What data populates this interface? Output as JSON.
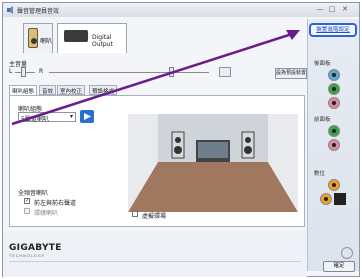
{
  "window": {
    "title": "聲音管理員音效",
    "controls": [
      "—",
      "□",
      "✕"
    ]
  },
  "device_tabs": [
    {
      "label": "喇叭",
      "icon": "speaker-icon"
    },
    {
      "label": "Digital Output",
      "icon": "digital-output-icon"
    }
  ],
  "main_volume": {
    "label": "主音量",
    "left": "L",
    "right": "R",
    "set_default": "設為預設裝置"
  },
  "inner_tabs": [
    "喇叭組態",
    "音效",
    "室內校正",
    "預設格式"
  ],
  "speaker_config": {
    "label": "喇叭組態",
    "selected": "5聲道喇叭"
  },
  "fullrange": {
    "title": "全頻音喇叭",
    "front": "前左與前右聲道",
    "surround": "環繞喇叭",
    "front_checked": true,
    "surround_checked": false
  },
  "virtual_surround": "虛擬環場",
  "right_panel": {
    "advanced_link": "裝置進階設定",
    "back_panel": "後面板",
    "front_panel": "前面板",
    "digital": "數位"
  },
  "brand": {
    "name": "GIGABYTE",
    "tagline": "TECHNOLOGY"
  },
  "ok_label": "確定",
  "colors": {
    "accent": "#2c63d6",
    "arrow": "#6a1b8e",
    "jack_blue": "#5aa7d8",
    "jack_green": "#3aa34a",
    "jack_pink": "#e0889d",
    "jack_orange": "#f0a020"
  }
}
